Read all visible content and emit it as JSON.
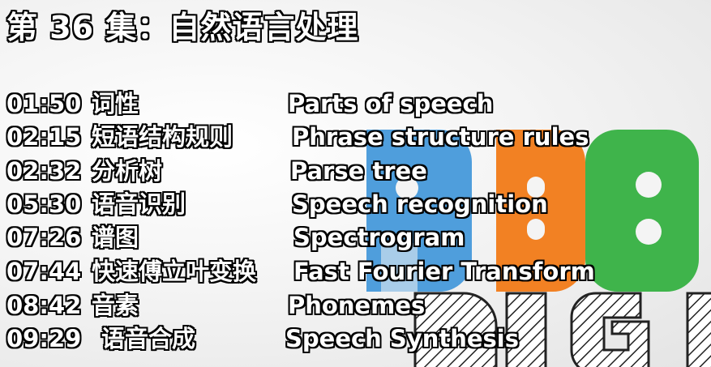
{
  "title": "第 36 集：自然语言处理",
  "logo": {
    "letters": [
      "P",
      "B",
      "S"
    ],
    "word": "DIGIT",
    "colors": [
      "#4f9edc",
      "#f28123",
      "#3fb44b"
    ]
  },
  "entries": [
    {
      "time": "01:50",
      "zh": "词性",
      "en": "Parts of speech"
    },
    {
      "time": "02:15",
      "zh": "短语结构规则",
      "en": "Phrase structure rules"
    },
    {
      "time": "02:32",
      "zh": "分析树",
      "en": "Parse tree"
    },
    {
      "time": "05:30",
      "zh": "语音识别",
      "en": "Speech recognition"
    },
    {
      "time": "07:26",
      "zh": "谱图",
      "en": "Spectrogram"
    },
    {
      "time": "07:44",
      "zh": "快速傅立叶变换",
      "en": "Fast Fourier Transform"
    },
    {
      "time": "08:42",
      "zh": "音素",
      "en": "Phonemes"
    },
    {
      "time": "09:29",
      "zh": "语音合成",
      "en": "Speech Synthesis"
    }
  ]
}
